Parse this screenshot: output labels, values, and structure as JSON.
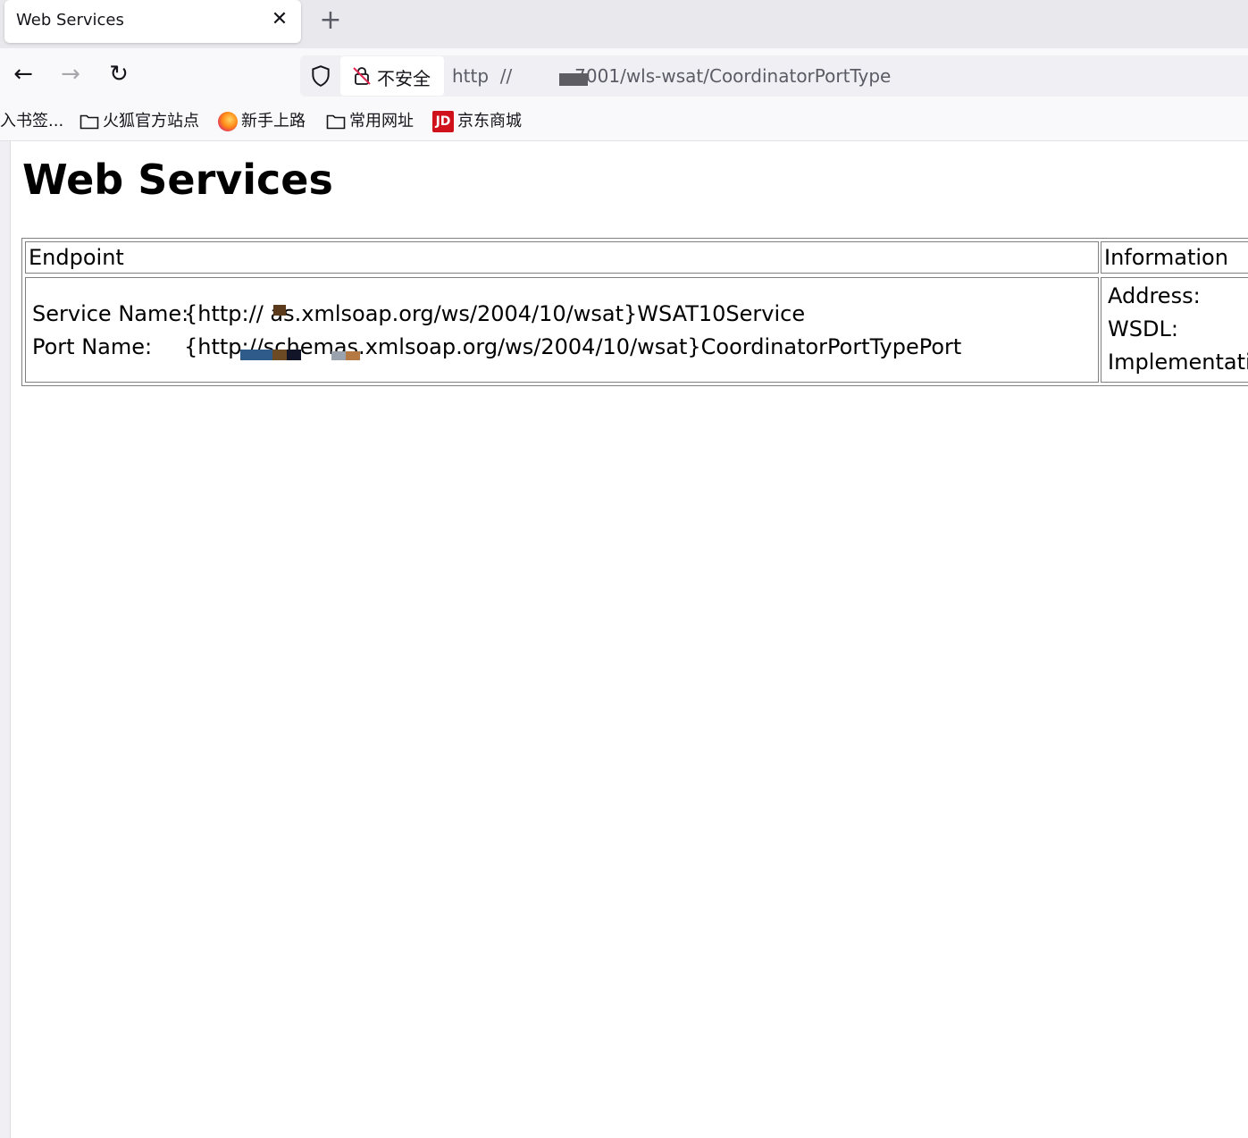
{
  "browser": {
    "tab": {
      "title": "Web Services",
      "close_symbol": "✕"
    },
    "new_tab_symbol": "+",
    "nav": {
      "back_symbol": "←",
      "forward_symbol": "→",
      "reload_symbol": "↻"
    },
    "urlbar": {
      "security_label": "不安全",
      "url": "http  //           7001/wls-wsat/CoordinatorPortType"
    },
    "bookmarks": [
      {
        "label": "入书签...",
        "icon": "none"
      },
      {
        "label": "火狐官方站点",
        "icon": "folder-icon"
      },
      {
        "label": "新手上路",
        "icon": "firefox-icon"
      },
      {
        "label": "常用网址",
        "icon": "folder-icon"
      },
      {
        "label": "京东商城",
        "icon": "jd-icon"
      }
    ],
    "jd_icon_text": "JD"
  },
  "page": {
    "title": "Web Services",
    "table": {
      "headers": [
        "Endpoint",
        "Information"
      ],
      "endpoint": {
        "service_name_label": "Service Name:",
        "service_name_value": "{http://         as.xmlsoap.org/ws/2004/10/wsat}WSAT10Service",
        "port_name_label": "Port Name:",
        "port_name_value": "{http://schemas.xmlsoap.org/ws/2004/10/wsat}CoordinatorPortTypePort"
      },
      "information": {
        "address_label": "Address:",
        "wsdl_label": "WSDL:",
        "implementation_label": "Implementatio"
      }
    }
  }
}
